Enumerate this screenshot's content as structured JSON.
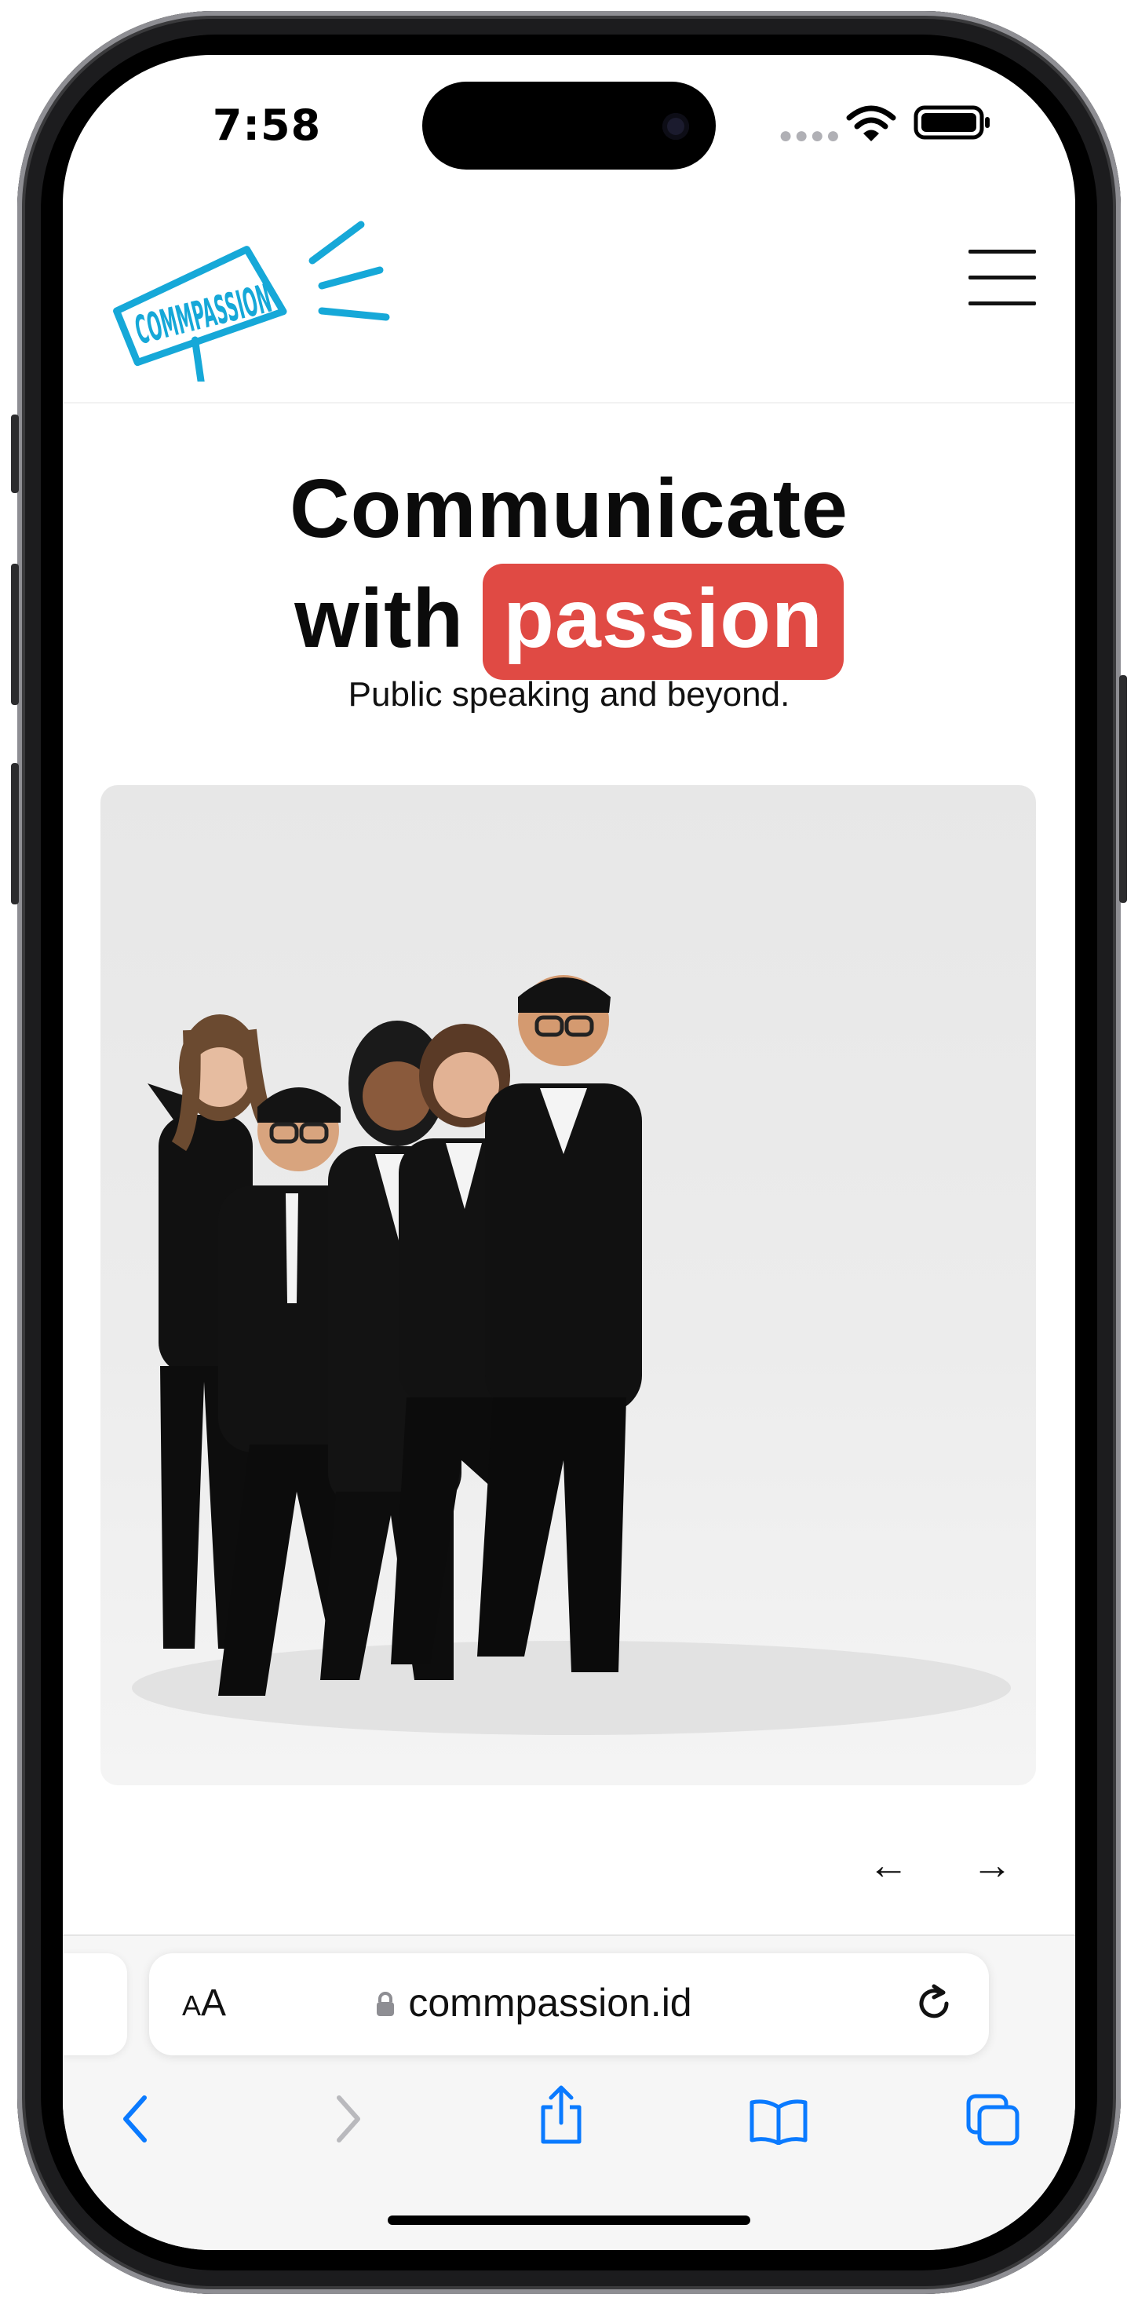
{
  "status_bar": {
    "time": "7:58"
  },
  "header": {
    "logo_text": "COMMPASSION"
  },
  "hero": {
    "line1": "Communicate",
    "line2_prefix": "with",
    "line2_highlight": "passion",
    "tagline": "Public speaking and beyond."
  },
  "carousel": {
    "prev_icon": "arrow-left-icon",
    "next_icon": "arrow-right-icon",
    "prev_glyph": "←",
    "next_glyph": "→"
  },
  "browser": {
    "text_size_small": "A",
    "text_size_large": "A",
    "url": "commpassion.id"
  },
  "colors": {
    "accent": "#e04a44",
    "logo": "#16a8d8",
    "ios_blue": "#0a7aff"
  }
}
